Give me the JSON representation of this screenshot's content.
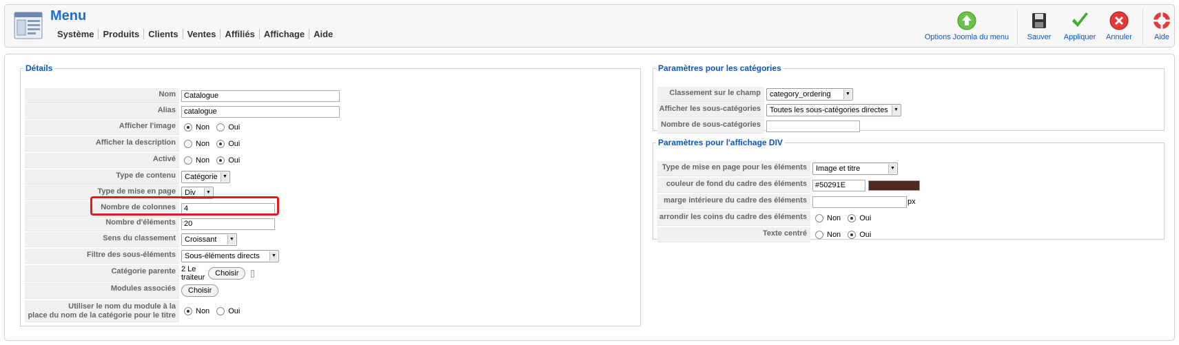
{
  "toolbar": {
    "title": "Menu",
    "nav": [
      "Système",
      "Produits",
      "Clients",
      "Ventes",
      "Affiliés",
      "Affichage",
      "Aide"
    ],
    "buttons": {
      "options": "Options Joomla du menu",
      "save": "Sauver",
      "apply": "Appliquer",
      "cancel": "Annuler",
      "help": "Aide"
    }
  },
  "details": {
    "legend": "Détails",
    "name_label": "Nom",
    "name_value": "Catalogue",
    "alias_label": "Alias",
    "alias_value": "catalogue",
    "show_image_label": "Afficher l'image",
    "show_desc_label": "Afficher la description",
    "active_label": "Activé",
    "no": "Non",
    "yes": "Oui",
    "content_type_label": "Type de contenu",
    "content_type_value": "Catégorie",
    "layout_type_label": "Type de mise en page",
    "layout_type_value": "Div",
    "columns_label": "Nombre de colonnes",
    "columns_value": "4",
    "items_label": "Nombre d'éléments",
    "items_value": "20",
    "sort_label": "Sens du classement",
    "sort_value": "Croissant",
    "filter_label": "Filtre des sous-éléments",
    "filter_value": "Sous-éléments directs",
    "parent_label": "Catégorie parente",
    "parent_value": "2 Le traiteur",
    "choose": "Choisir",
    "modules_label": "Modules associés",
    "use_module_name_label_1": "Utiliser le nom du module à la",
    "use_module_name_label_2": "place du nom de la catégorie pour le titre"
  },
  "categories": {
    "legend": "Paramètres pour les catégories",
    "ordering_label": "Classement sur le champ",
    "ordering_value": "category_ordering",
    "show_sub_label": "Afficher les sous-catégories",
    "show_sub_value": "Toutes les sous-catégories directes",
    "num_sub_label": "Nombre de sous-catégories",
    "num_sub_value": ""
  },
  "div_display": {
    "legend": "Paramètres pour l'affichage DIV",
    "layout_label": "Type de mise en page pour les éléments",
    "layout_value": "Image et titre",
    "bg_label": "couleur de fond du cadre des éléments",
    "bg_value": "#50291E",
    "bg_color": "#50291E",
    "padding_label": "marge intérieure du cadre des éléments",
    "padding_value": "",
    "padding_unit": "px",
    "round_label": "arrondir les coins du cadre des éléments",
    "center_label": "Texte centré",
    "no": "Non",
    "yes": "Oui"
  }
}
